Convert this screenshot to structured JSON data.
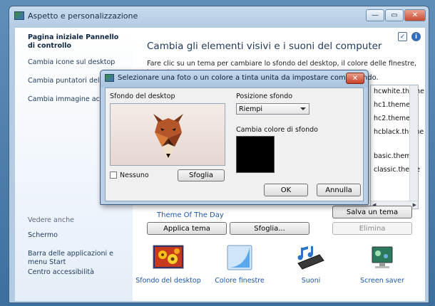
{
  "window": {
    "title": "Aspetto e personalizzazione",
    "min": "—",
    "max": "▭",
    "close": "✕"
  },
  "sidebar": {
    "items": [
      {
        "label": "Pagina iniziale Pannello di controllo",
        "bold": true
      },
      {
        "label": "Cambia icone sul desktop"
      },
      {
        "label": "Cambia puntatori del mouse"
      },
      {
        "label": "Cambia immagine account"
      }
    ],
    "see_also_title": "Vedere anche",
    "see_also": [
      {
        "label": "Schermo"
      },
      {
        "label": "Barra delle applicazioni e menu Start"
      },
      {
        "label": "Centro accessibilità"
      }
    ]
  },
  "main": {
    "heading": "Cambia gli elementi visivi e i suoni del computer",
    "description": "Fare clic su un tema per cambiare lo sfondo del desktop, il colore delle finestre, i suoni e lo screen saver contemporaneamente.",
    "themes": [
      "hcwhite.theme",
      "hc1.theme",
      "hc2.theme",
      "hcblack.theme",
      "basic.theme",
      "classic.theme"
    ],
    "theme_link": "Theme Of The Day",
    "save_theme": "Salva un tema",
    "apply_theme": "Applica tema",
    "browse": "Sfoglia...",
    "delete": "Elimina",
    "bottom": [
      {
        "label": "Sfondo del desktop",
        "icon": "desktop-background-icon"
      },
      {
        "label": "Colore finestre",
        "icon": "window-color-icon"
      },
      {
        "label": "Suoni",
        "icon": "sounds-icon"
      },
      {
        "label": "Screen saver",
        "icon": "screen-saver-icon"
      }
    ]
  },
  "dialog": {
    "title": "Selezionare una foto o un colore a tinta unita da impostare come sfondo.",
    "desktop_bg_label": "Sfondo del desktop",
    "none_label": "Nessuno",
    "browse_label": "Sfoglia",
    "position_label": "Posizione sfondo",
    "position_value": "Riempi",
    "color_label": "Cambia colore di sfondo",
    "ok": "OK",
    "cancel": "Annulla",
    "swatch_color": "#000000"
  }
}
